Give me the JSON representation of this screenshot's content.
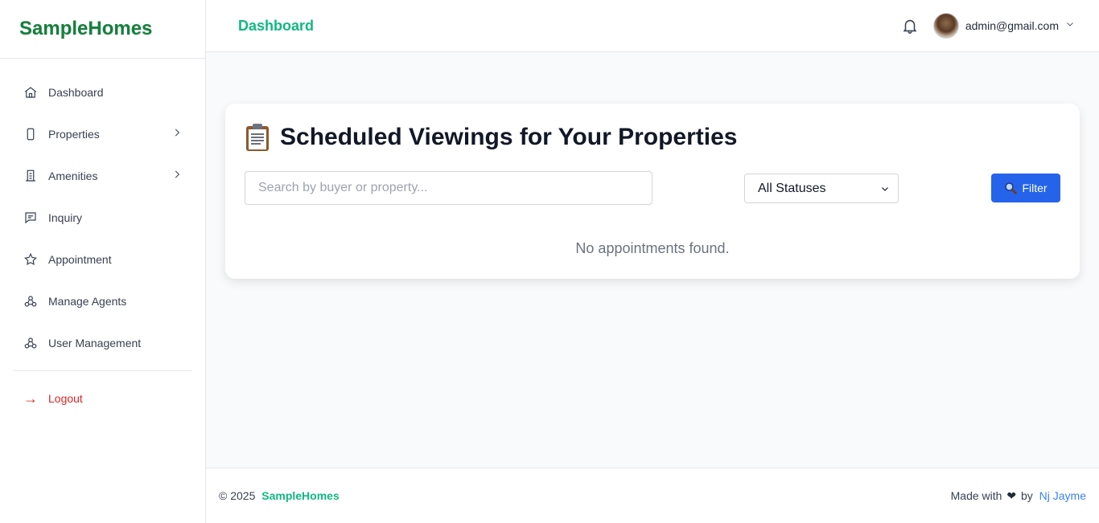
{
  "sidebar": {
    "brand": "SampleHomes",
    "items": [
      {
        "label": "Dashboard",
        "icon": "home-icon"
      },
      {
        "label": "Properties",
        "icon": "phone-icon",
        "has_submenu": true
      },
      {
        "label": "Amenities",
        "icon": "building-icon",
        "has_submenu": true
      },
      {
        "label": "Inquiry",
        "icon": "message-icon"
      },
      {
        "label": "Appointment",
        "icon": "star-icon"
      },
      {
        "label": "Manage Agents",
        "icon": "users-icon"
      },
      {
        "label": "User Management",
        "icon": "users-icon"
      }
    ],
    "logout": {
      "label": "Logout",
      "icon": "arrow-right-icon",
      "glyph": "→"
    }
  },
  "header": {
    "title": "Dashboard",
    "user_email": "admin@gmail.com"
  },
  "main": {
    "card_title": "Scheduled Viewings for Your Properties",
    "search_placeholder": "Search by buyer or property...",
    "status_select": "All Statuses",
    "filter_label": "Filter",
    "empty_message": "No appointments found."
  },
  "footer": {
    "copyright": "© 2025",
    "brand": "SampleHomes",
    "made_with": "Made with",
    "heart": "❤",
    "by": "by",
    "author": "Nj Jayme"
  },
  "colors": {
    "brand_green": "#15803d",
    "accent_green": "#10b981",
    "primary_blue": "#2563eb",
    "danger_red": "#dc2626",
    "link_blue": "#3b82f6"
  }
}
